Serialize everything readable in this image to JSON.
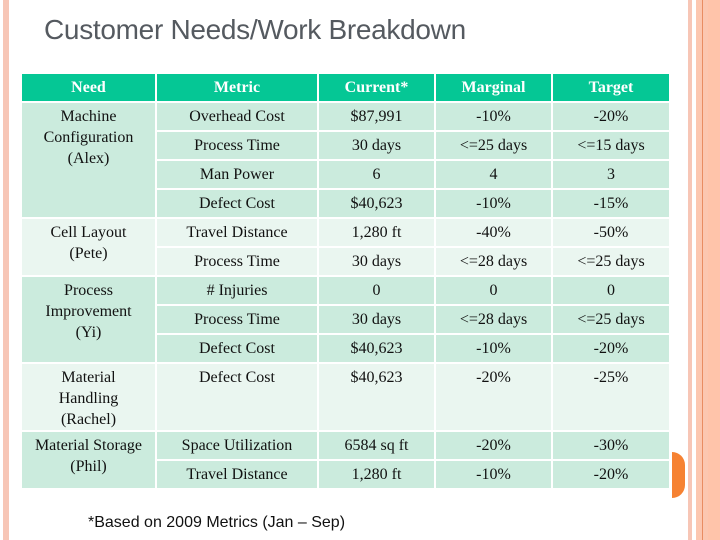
{
  "slide": {
    "title": "Customer Needs/Work Breakdown",
    "footnote": "*Based on 2009 Metrics (Jan – Sep)",
    "colors": {
      "header_bg": "#05C795",
      "row_dark": "#CBEBDD",
      "row_light": "#EAF6F0",
      "accent_orange": "#F68232",
      "border_pink": "#F7C6B6"
    }
  },
  "table": {
    "headers": [
      "Need",
      "Metric",
      "Current*",
      "Marginal",
      "Target"
    ],
    "groups": [
      {
        "need": "Machine Configuration (Alex)",
        "need_lines": [
          "Machine",
          "Configuration",
          "(Alex)"
        ],
        "shade": "dark",
        "rows": [
          {
            "metric": "Overhead Cost",
            "current": "$87,991",
            "marginal": "-10%",
            "target": "-20%"
          },
          {
            "metric": "Process Time",
            "current": "30 days",
            "marginal": "<=25 days",
            "target": "<=15 days"
          },
          {
            "metric": "Man Power",
            "current": "6",
            "marginal": "4",
            "target": "3"
          },
          {
            "metric": "Defect Cost",
            "current": "$40,623",
            "marginal": "-10%",
            "target": "-15%"
          }
        ]
      },
      {
        "need": "Cell Layout (Pete)",
        "need_lines": [
          "Cell Layout",
          "(Pete)"
        ],
        "shade": "light",
        "rows": [
          {
            "metric": "Travel Distance",
            "current": "1,280 ft",
            "marginal": "-40%",
            "target": "-50%"
          },
          {
            "metric": "Process Time",
            "current": "30 days",
            "marginal": "<=28 days",
            "target": "<=25 days"
          }
        ]
      },
      {
        "need": "Process Improvement (Yi)",
        "need_lines": [
          "Process",
          "Improvement",
          "(Yi)"
        ],
        "shade": "dark",
        "rows": [
          {
            "metric": "# Injuries",
            "current": "0",
            "marginal": "0",
            "target": "0"
          },
          {
            "metric": "Process Time",
            "current": "30 days",
            "marginal": "<=28 days",
            "target": "<=25 days"
          },
          {
            "metric": "Defect Cost",
            "current": "$40,623",
            "marginal": "-10%",
            "target": "-20%"
          }
        ]
      },
      {
        "need": "Material Handling (Rachel)",
        "need_lines": [
          "Material",
          "Handling",
          "(Rachel)"
        ],
        "shade": "light",
        "rows": [
          {
            "metric": "Defect Cost",
            "current": "$40,623",
            "marginal": "-20%",
            "target": "-25%"
          }
        ]
      },
      {
        "need": "Material Storage (Phil)",
        "need_lines": [
          "Material Storage",
          "(Phil)"
        ],
        "shade": "dark",
        "rows": [
          {
            "metric": "Space Utilization",
            "current": "6584 sq ft",
            "marginal": "-20%",
            "target": "-30%"
          },
          {
            "metric": "Travel Distance",
            "current": "1,280 ft",
            "marginal": "-10%",
            "target": "-20%"
          }
        ]
      }
    ]
  }
}
